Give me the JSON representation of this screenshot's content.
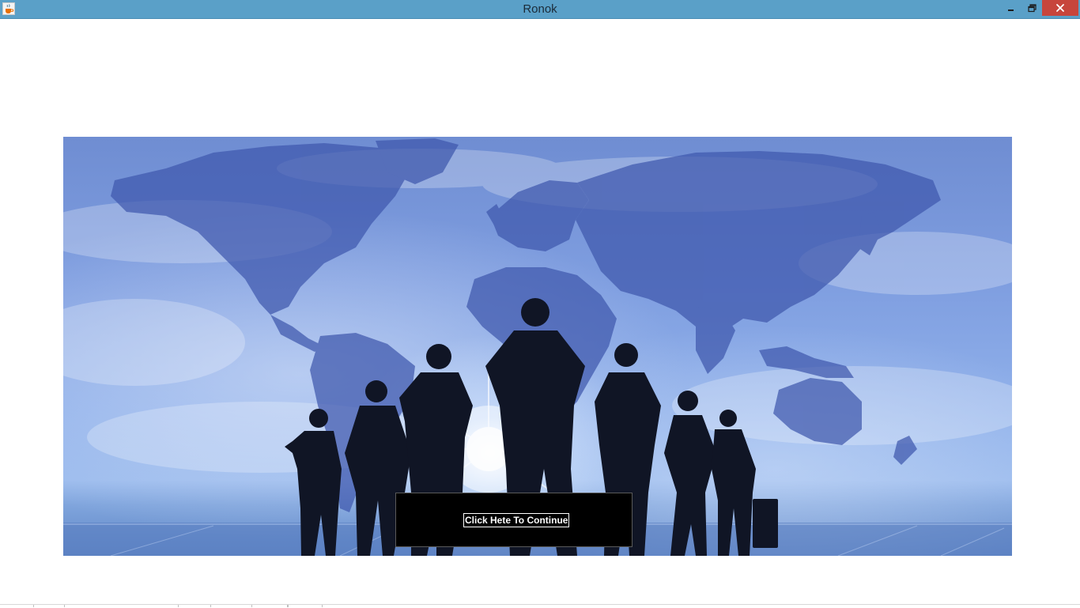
{
  "window": {
    "title": "Ronok",
    "icon": "java-cup-icon",
    "controls": {
      "minimize": "minimize-icon",
      "maximize": "restore-icon",
      "close": "close-icon"
    },
    "colors": {
      "titlebar": "#5aa0c8",
      "close_button": "#c7453c"
    }
  },
  "splash": {
    "image": "world-map-business-silhouettes",
    "continue_label": "Click Hete To Continue"
  }
}
